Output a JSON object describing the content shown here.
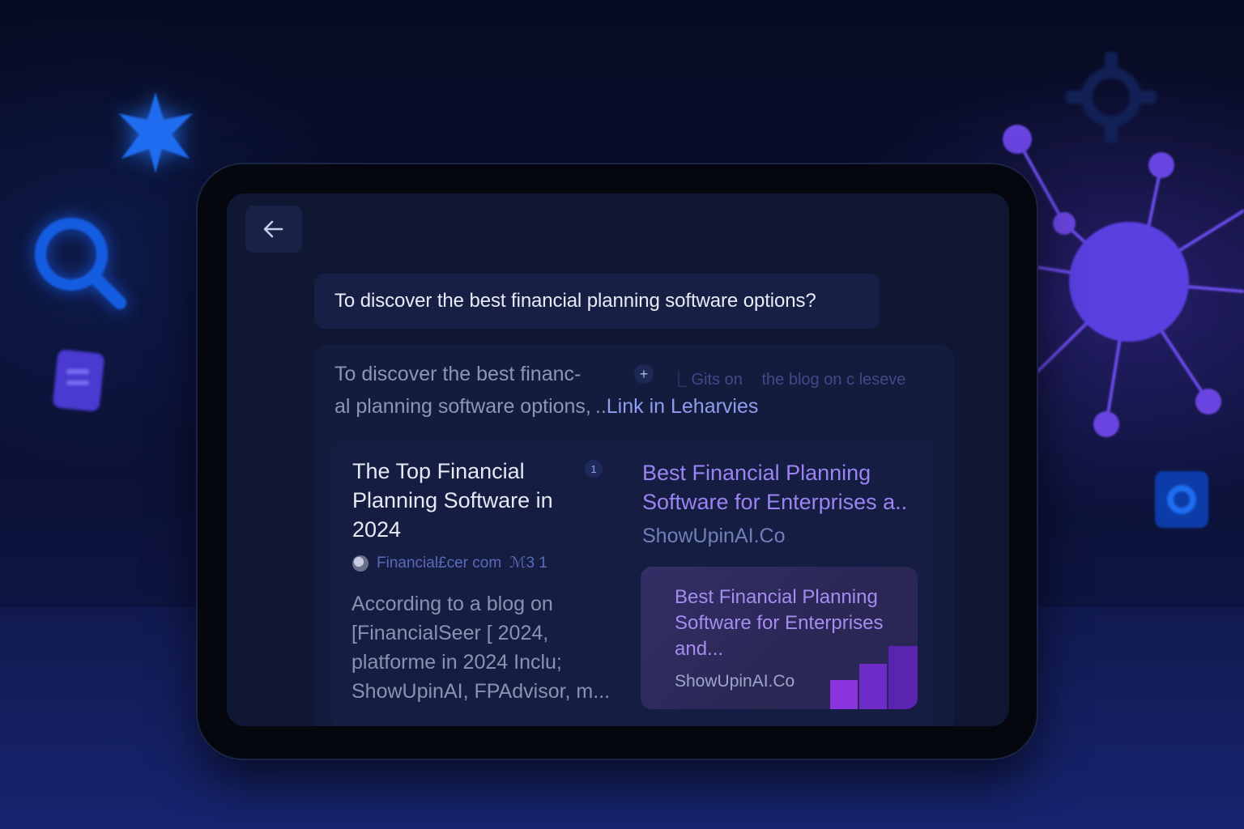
{
  "screen": {
    "back_label": "Back",
    "query": "To discover the best financial planning software options?",
    "answer": {
      "line1": "To discover the best financ-",
      "line2_prefix": "al planning software options, ..",
      "link_text": "Link in Leharvies",
      "plus": "+",
      "faint_links": [
        "⎿ Gits on",
        "the blog on c leseve"
      ]
    },
    "card_left": {
      "title": "The Top Financial Planning Software in 2024",
      "citation": "1",
      "source": "Financial£cer com",
      "source_extra": "ℳ3 1",
      "body": "According to a blog on [FinancialSeer [ 2024, platforme in 2024 Inclu; ShowUpinAI, FPAdvisor, m..."
    },
    "card_right": {
      "title": "Best Financial Planning Software for Enterprises a..",
      "source": "ShowUpinAI.Co",
      "preview": {
        "title": "Best Financial Planning Software for Enterprises and...",
        "source": "ShowUpinAI.Co"
      }
    }
  },
  "colors": {
    "accent": "#9b84f2",
    "link": "#8f9df0",
    "background": "#0a0f2a"
  },
  "icons": [
    "star-icon",
    "search-icon",
    "document-icon",
    "gear-icon",
    "network-icon",
    "square-icon",
    "arrow-left-icon",
    "plus-icon",
    "bar-chart-icon"
  ]
}
